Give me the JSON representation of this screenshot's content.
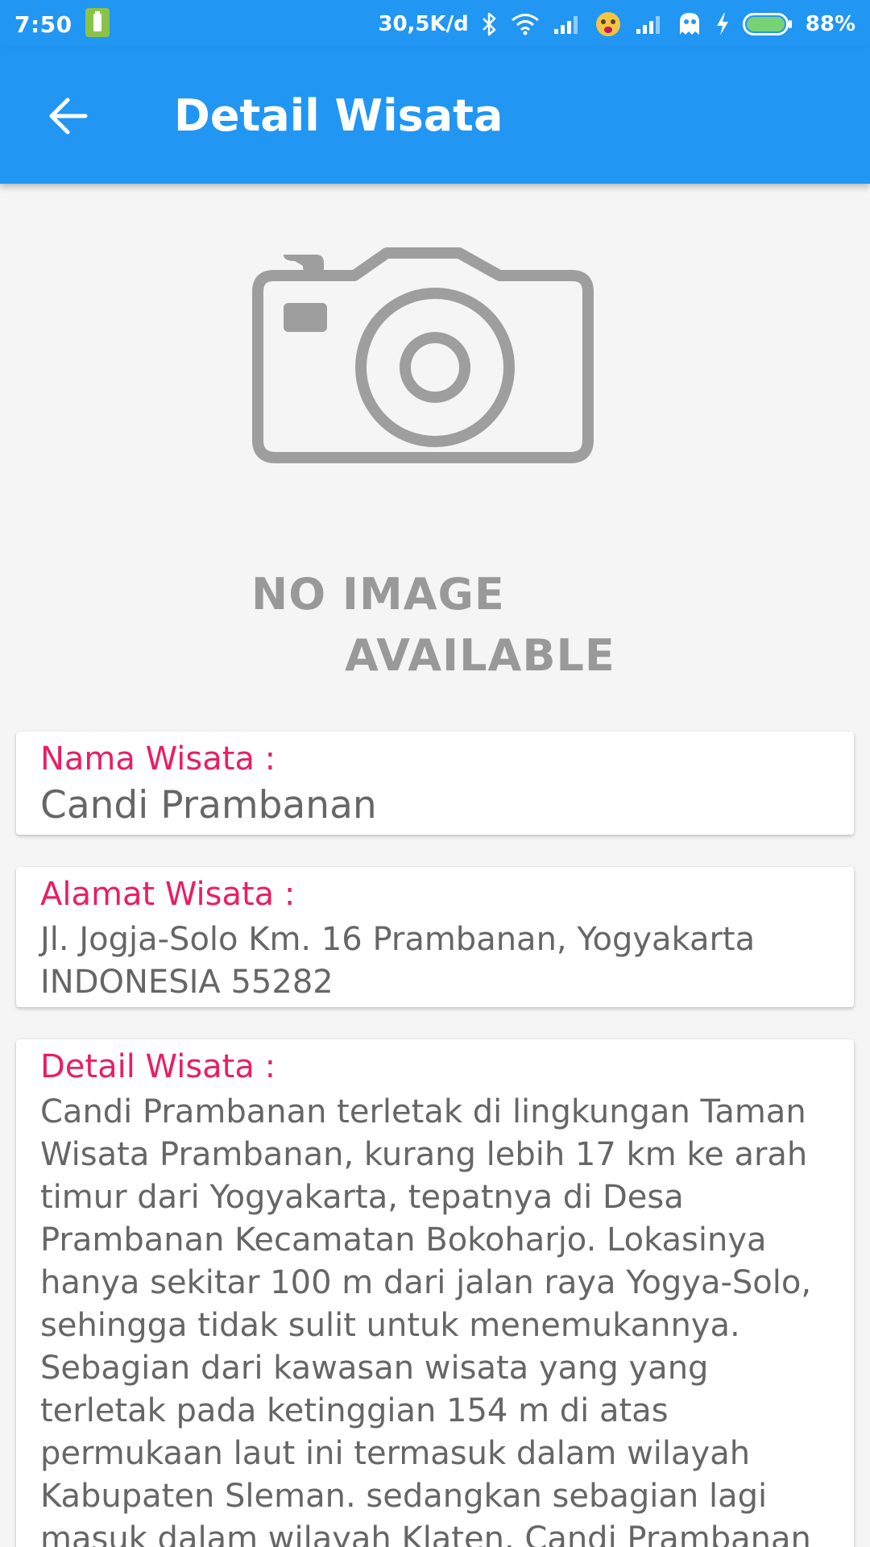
{
  "status_bar": {
    "time": "7:50",
    "network_speed": "30,5K/d",
    "battery_percent": "88%",
    "battery_level": 0.88
  },
  "app_bar": {
    "title": "Detail Wisata"
  },
  "placeholder_image": {
    "line1": "NO IMAGE",
    "line2": "AVAILABLE"
  },
  "cards": {
    "name": {
      "label": "Nama Wisata :",
      "value": "Candi Prambanan"
    },
    "address": {
      "label": "Alamat Wisata :",
      "value": "Jl. Jogja-Solo Km. 16 Prambanan, Yogyakarta INDONESIA 55282"
    },
    "detail": {
      "label": "Detail Wisata :",
      "value": "Candi Prambanan terletak di lingkungan Taman Wisata Prambanan, kurang lebih 17 km ke arah timur dari Yogyakarta, tepatnya di Desa Prambanan Kecamatan Bokoharjo. Lokasinya hanya sekitar 100 m dari jalan raya Yogya-Solo, sehingga tidak sulit untuk menemukannya. Sebagian dari kawasan wisata yang yang terletak pada ketinggian 154 m di atas permukaan laut ini termasuk dalam wilayah Kabupaten Sleman. sedangkan sebagian lagi masuk dalam wilayah Klaten. Candi Prambanan merupakan candi Hindu"
    }
  },
  "colors": {
    "primary": "#2196f3",
    "accent": "#e91e63",
    "background": "#f5f5f5",
    "card": "#ffffff",
    "text_secondary": "#666666"
  }
}
